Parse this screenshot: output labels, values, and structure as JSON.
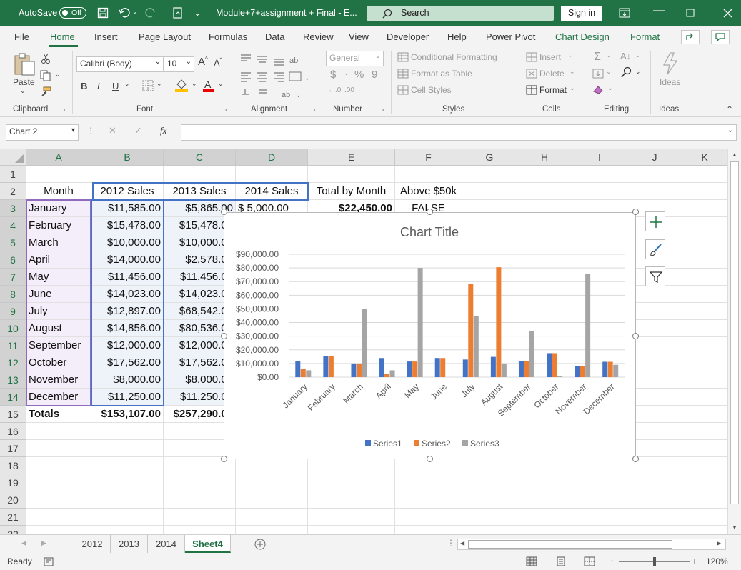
{
  "titlebar": {
    "autosave_label": "AutoSave",
    "autosave_state": "Off",
    "file_title": "Module+7+assignment + Final  -  E...",
    "search_placeholder": "Search",
    "signin_label": "Sign in"
  },
  "menu": [
    "File",
    "Home",
    "Insert",
    "Page Layout",
    "Formulas",
    "Data",
    "Review",
    "View",
    "Developer",
    "Help",
    "Power Pivot",
    "Chart Design",
    "Format"
  ],
  "ribbon": {
    "clipboard": {
      "paste": "Paste",
      "label": "Clipboard"
    },
    "font": {
      "name": "Calibri (Body)",
      "size": "10",
      "bold": "B",
      "italic": "I",
      "underline": "U",
      "label": "Font"
    },
    "alignment": {
      "label": "Alignment"
    },
    "number": {
      "format": "General",
      "currency": "$",
      "percent": "%",
      "comma": "9",
      "label": "Number"
    },
    "styles": {
      "conditional": "Conditional Formatting",
      "table": "Format as Table",
      "cell": "Cell Styles",
      "label": "Styles"
    },
    "cells": {
      "insert": "Insert",
      "delete": "Delete",
      "format": "Format",
      "label": "Cells"
    },
    "editing": {
      "label": "Editing"
    },
    "ideas": {
      "button": "Ideas",
      "label": "Ideas"
    }
  },
  "formula_bar": {
    "name_box": "Chart 2",
    "fx": "fx",
    "value": ""
  },
  "columns": [
    "A",
    "B",
    "C",
    "D",
    "E",
    "F",
    "G",
    "H",
    "I",
    "J",
    "K"
  ],
  "rows": [
    "1",
    "2",
    "3",
    "4",
    "5",
    "6",
    "7",
    "8",
    "9",
    "10",
    "11",
    "12",
    "13",
    "14",
    "15",
    "16",
    "17",
    "18",
    "19",
    "20",
    "21",
    "22"
  ],
  "headers": {
    "a": "Month",
    "b": "2012 Sales",
    "c": "2013 Sales",
    "d": "2014 Sales",
    "e": "Total by Month",
    "f": "Above $50k"
  },
  "row3_extra": {
    "d": "$   5,000.00",
    "e": "$22,450.00",
    "f": "FALSE"
  },
  "data_rows": [
    {
      "month": "January",
      "b": "$11,585.00",
      "c": "$5,865.00"
    },
    {
      "month": "February",
      "b": "$15,478.00",
      "c": "$15,478.00"
    },
    {
      "month": "March",
      "b": "$10,000.00",
      "c": "$10,000.00"
    },
    {
      "month": "April",
      "b": "$14,000.00",
      "c": "$2,578.00"
    },
    {
      "month": "May",
      "b": "$11,456.00",
      "c": "$11,456.00"
    },
    {
      "month": "June",
      "b": "$14,023.00",
      "c": "$14,023.00"
    },
    {
      "month": "July",
      "b": "$12,897.00",
      "c": "$68,542.00"
    },
    {
      "month": "August",
      "b": "$14,856.00",
      "c": "$80,536.00"
    },
    {
      "month": "September",
      "b": "$12,000.00",
      "c": "$12,000.00"
    },
    {
      "month": "October",
      "b": "$17,562.00",
      "c": "$17,562.00"
    },
    {
      "month": "November",
      "b": "$8,000.00",
      "c": "$8,000.00"
    },
    {
      "month": "December",
      "b": "$11,250.00",
      "c": "$11,250.00"
    }
  ],
  "totals": {
    "label": "Totals",
    "b": "$153,107.00",
    "c": "$257,290.00"
  },
  "chart_data": {
    "type": "bar",
    "title": "Chart Title",
    "categories": [
      "January",
      "February",
      "March",
      "April",
      "May",
      "June",
      "July",
      "August",
      "September",
      "October",
      "November",
      "December"
    ],
    "series": [
      {
        "name": "Series1",
        "color": "#4472C4",
        "values": [
          11585,
          15478,
          10000,
          14000,
          11456,
          14023,
          12897,
          14856,
          12000,
          17562,
          8000,
          11250
        ]
      },
      {
        "name": "Series2",
        "color": "#ED7D31",
        "values": [
          5865,
          15478,
          10000,
          2578,
          11456,
          14023,
          68542,
          80536,
          12000,
          17562,
          8000,
          11250
        ]
      },
      {
        "name": "Series3",
        "color": "#A5A5A5",
        "values": [
          5000,
          0,
          50000,
          5000,
          80000,
          0,
          45000,
          10000,
          34000,
          500,
          75500,
          9000
        ]
      }
    ],
    "ylim": [
      0,
      90000
    ],
    "yticks": [
      "$0.00",
      "$10,000.00",
      "$20,000.00",
      "$30,000.00",
      "$40,000.00",
      "$50,000.00",
      "$60,000.00",
      "$70,000.00",
      "$80,000.00",
      "$90,000.00"
    ],
    "legend": "bottom",
    "grid": true
  },
  "sheet_tabs": [
    "2012",
    "2013",
    "2014",
    "Sheet4"
  ],
  "active_tab": "Sheet4",
  "status": {
    "ready": "Ready",
    "zoom": "120%",
    "minus": "-",
    "plus": "+"
  }
}
